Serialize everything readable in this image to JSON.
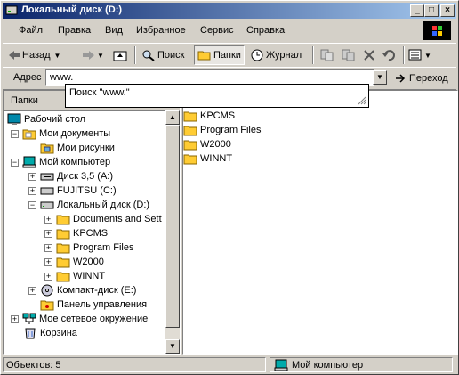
{
  "window": {
    "title": "Локальный диск (D:)",
    "min": "_",
    "max": "□",
    "close": "×"
  },
  "menu": [
    "Файл",
    "Правка",
    "Вид",
    "Избранное",
    "Сервис",
    "Справка"
  ],
  "toolbar": {
    "back": "Назад",
    "search": "Поиск",
    "folders": "Папки",
    "history": "Журнал"
  },
  "address": {
    "label": "Адрес",
    "value": "www.",
    "go": "Переход"
  },
  "autocomplete": {
    "text": "Поиск \"www.\""
  },
  "left_panel": {
    "title": "Папки",
    "close": "×"
  },
  "tree": [
    {
      "label": "Рабочий стол",
      "icon": "desktop-icon"
    },
    {
      "label": "Мои документы",
      "icon": "folder-icon"
    },
    {
      "label": "Мои рисунки",
      "icon": "folder-icon"
    },
    {
      "label": "Мой компьютер",
      "icon": "computer-icon"
    },
    {
      "label": "Диск 3,5 (A:)",
      "icon": "floppy-icon"
    },
    {
      "label": "FUJITSU (C:)",
      "icon": "drive-icon"
    },
    {
      "label": "Локальный диск (D:)",
      "icon": "drive-icon"
    },
    {
      "label": "Documents and Sett",
      "icon": "folder-icon"
    },
    {
      "label": "KPCMS",
      "icon": "folder-icon"
    },
    {
      "label": "Program Files",
      "icon": "folder-icon"
    },
    {
      "label": "W2000",
      "icon": "folder-icon"
    },
    {
      "label": "WINNT",
      "icon": "folder-icon"
    },
    {
      "label": "Компакт-диск (E:)",
      "icon": "cd-icon"
    },
    {
      "label": "Панель управления",
      "icon": "control-panel-icon"
    },
    {
      "label": "Мое сетевое окружение",
      "icon": "network-icon"
    },
    {
      "label": "Корзина",
      "icon": "recycle-bin-icon"
    }
  ],
  "files": [
    "KPCMS",
    "Program Files",
    "W2000",
    "WINNT"
  ],
  "status": {
    "objects": "Объектов: 5",
    "location": "Мой компьютер"
  }
}
